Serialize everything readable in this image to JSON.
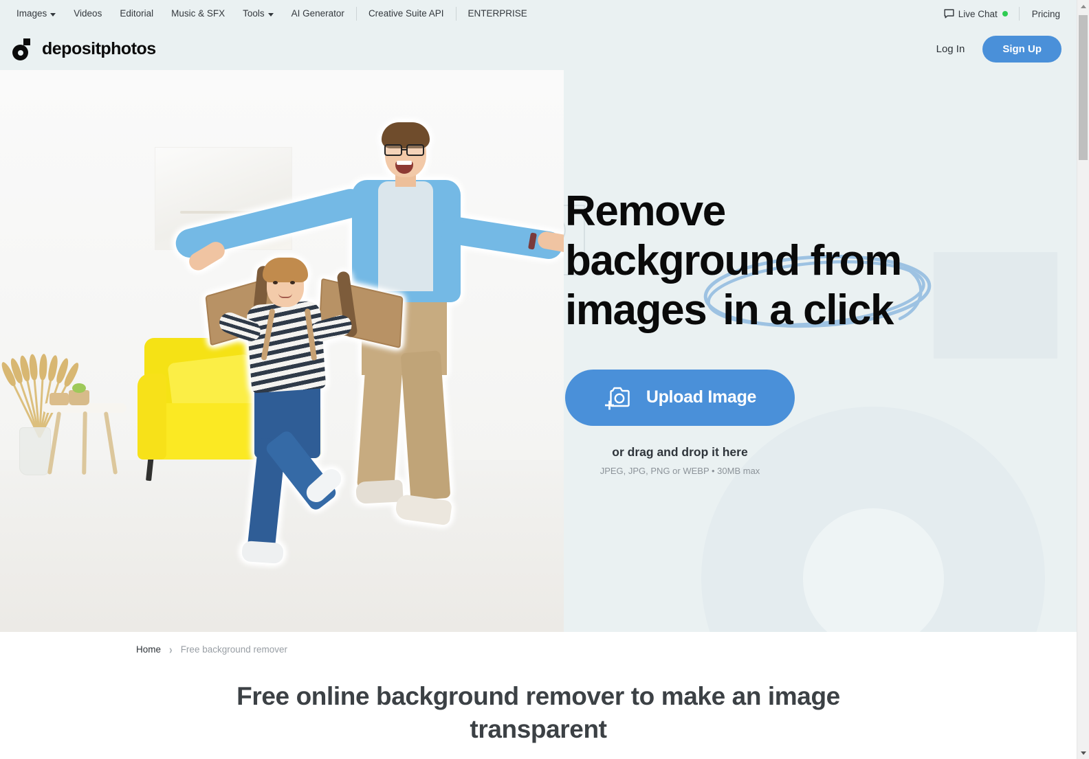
{
  "topbar": {
    "nav": [
      {
        "label": "Images",
        "has_caret": true
      },
      {
        "label": "Videos",
        "has_caret": false
      },
      {
        "label": "Editorial",
        "has_caret": false
      },
      {
        "label": "Music & SFX",
        "has_caret": false
      },
      {
        "label": "Tools",
        "has_caret": true
      },
      {
        "label": "AI Generator",
        "has_caret": false
      },
      {
        "label": "Creative Suite API",
        "has_caret": false
      },
      {
        "label": "ENTERPRISE",
        "has_caret": false
      }
    ],
    "live_chat_label": "Live Chat",
    "live_chat_status_color": "#2ecc52",
    "pricing_label": "Pricing"
  },
  "header": {
    "logo_text": "depositphotos",
    "logo_icon": "camera-dot-logo-icon",
    "login_label": "Log In",
    "signup_label": "Sign Up",
    "signup_color": "#4a90d9"
  },
  "hero": {
    "background_color": "#eaf1f2",
    "title_line1": "Remove",
    "title_line2": "background from",
    "title_line3_plain": "images",
    "title_line3_circled": "in a click",
    "circle_highlight_color": "#9dc2e2",
    "upload_button_label": "Upload Image",
    "upload_button_icon": "camera-plus-icon",
    "upload_button_color": "#4a90d9",
    "drag_text": "or drag and drop it here",
    "formats_text": "JPEG, JPG, PNG or WEBP • 30MB max",
    "photo_alt": "father and son playing with cardboard airplane wings in a living room"
  },
  "below_hero": {
    "breadcrumb": {
      "home_label": "Home",
      "separator": "›",
      "current_label": "Free background remover"
    },
    "section_title": "Free online background remover to make an image transparent"
  },
  "scrollbar": {
    "up_icon": "scroll-up-arrow-icon",
    "down_icon": "scroll-down-arrow-icon",
    "thumb": "scrollbar-thumb"
  }
}
